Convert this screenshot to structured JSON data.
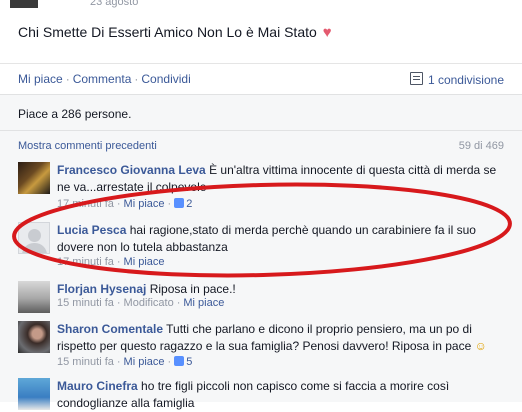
{
  "header": {
    "date": "23 agosto"
  },
  "post": {
    "text": "Chi Smette Di Esserti Amico Non Lo è Mai Stato",
    "emoji": "♥"
  },
  "actions": {
    "like": "Mi piace",
    "comment": "Commenta",
    "share": "Condividi",
    "share_count": "1 condivisione"
  },
  "likes": {
    "text": "Piace a 286 persone."
  },
  "comments_header": {
    "show_previous": "Mostra commenti precedenti",
    "count": "59 di 469"
  },
  "comments": [
    {
      "author": "Francesco Giovanna Leva",
      "text": "È un'altra vittima innocente di questa città di merda se ne va...arrestate il colpevole",
      "time": "17 minuti fa",
      "like": "Mi piace",
      "likes": "2"
    },
    {
      "author": "Lucia Pesca",
      "text": "hai ragione,stato di merda perchè quando un carabiniere fa il suo dovere non lo tutela abbastanza",
      "time": "17 minuti fa",
      "like": "Mi piace"
    },
    {
      "author": "Florjan Hysenaj",
      "text": "Riposa in pace.!",
      "time": "15 minuti fa",
      "modified": "Modificato",
      "like": "Mi piace"
    },
    {
      "author": "Sharon Comentale",
      "text": "Tutti che parlano e dicono il proprio pensiero, ma un po di rispetto per questo ragazzo e la sua famiglia? Penosi davvero! Riposa in pace",
      "emoji": "☺",
      "time": "15 minuti fa",
      "like": "Mi piace",
      "likes": "5"
    },
    {
      "author": "Mauro Cinefra",
      "text": "ho tre figli piccoli non capisco come si faccia a morire così condoglianze alla famiglia"
    }
  ],
  "colors": {
    "link": "#3b5998",
    "annotation": "#d7191c",
    "background": "#f6f7f8"
  }
}
